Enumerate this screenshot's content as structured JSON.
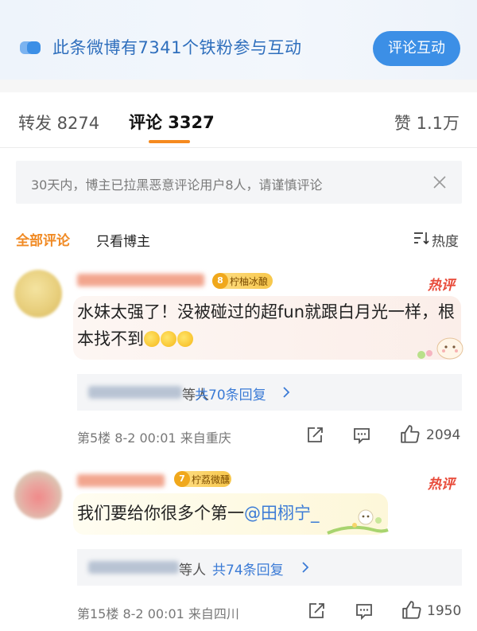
{
  "banner": {
    "text": "此条微博有7341个铁粉参与互动",
    "button": "评论互动"
  },
  "tabs": {
    "repost": "转发 8274",
    "comment": "评论 3327",
    "likes": "赞 1.1万"
  },
  "notice": {
    "text": "30天内，博主已拉黑恶意评论用户8人，请谨慎评论"
  },
  "filter": {
    "all": "全部评论",
    "owner_only": "只看博主",
    "sort": "热度"
  },
  "comments": [
    {
      "badge": "柠柚冰酿",
      "hot": "热评",
      "text_part1": "水妹太强了！没被碰过的超fun就跟白月光一样，根本找不到",
      "reply_suffix": "等人",
      "reply_count": "共70条回复",
      "floor": "第5楼",
      "date": "8-2 00:01",
      "location": "来自重庆",
      "likes": "2094"
    },
    {
      "badge": "柠荔微醺",
      "hot": "热评",
      "text": "我们要给你很多个第一",
      "mention": "@田栩宁_",
      "reply_suffix": "等人",
      "reply_count": "共74条回复",
      "floor": "第15楼",
      "date": "8-2 00:01",
      "location": "来自四川",
      "likes": "1950"
    }
  ],
  "colors": {
    "accent": "#f58a1f",
    "link": "#3b7bd6",
    "hot": "#e84b3a",
    "button": "#3c8fe6"
  }
}
